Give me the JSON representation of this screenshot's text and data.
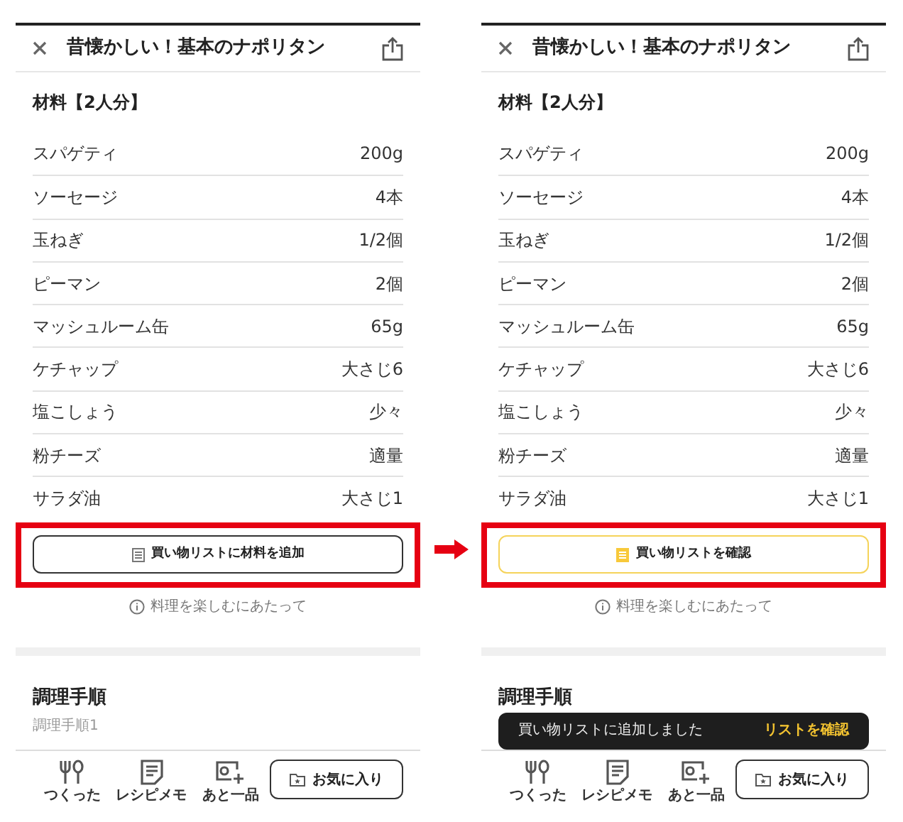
{
  "screens": [
    {
      "title": "昔懐かしい！基本のナポリタン",
      "section_title": "材料【2人分】",
      "ingredients": [
        {
          "name": "スパゲティ",
          "amount": "200g"
        },
        {
          "name": "ソーセージ",
          "amount": "4本"
        },
        {
          "name": "玉ねぎ",
          "amount": "1/2個"
        },
        {
          "name": "ピーマン",
          "amount": "2個"
        },
        {
          "name": "マッシュルーム缶",
          "amount": "65g"
        },
        {
          "name": "ケチャップ",
          "amount": "大さじ6"
        },
        {
          "name": "塩こしょう",
          "amount": "少々"
        },
        {
          "name": "粉チーズ",
          "amount": "適量"
        },
        {
          "name": "サラダ油",
          "amount": "大さじ1"
        }
      ],
      "list_button": {
        "label": "買い物リストに材料を追加",
        "added": false,
        "highlighted": true
      },
      "info_link": "料理を楽しむにあたって",
      "steps_title": "調理手順",
      "steps_subtitle": "調理手順1",
      "tab_bar": [
        {
          "kind": "cutlery",
          "label": "つくった"
        },
        {
          "kind": "memo",
          "label": "レシピメモ"
        },
        {
          "kind": "photo",
          "label": "あと一品"
        }
      ],
      "favorite_button": "お気に入り"
    },
    {
      "title": "昔懐かしい！基本のナポリタン",
      "section_title": "材料【2人分】",
      "ingredients": [
        {
          "name": "スパゲティ",
          "amount": "200g"
        },
        {
          "name": "ソーセージ",
          "amount": "4本"
        },
        {
          "name": "玉ねぎ",
          "amount": "1/2個"
        },
        {
          "name": "ピーマン",
          "amount": "2個"
        },
        {
          "name": "マッシュルーム缶",
          "amount": "65g"
        },
        {
          "name": "ケチャップ",
          "amount": "大さじ6"
        },
        {
          "name": "塩こしょう",
          "amount": "少々"
        },
        {
          "name": "粉チーズ",
          "amount": "適量"
        },
        {
          "name": "サラダ油",
          "amount": "大さじ1"
        }
      ],
      "list_button": {
        "label": "買い物リストを確認",
        "added": true,
        "highlighted": true
      },
      "info_link": "料理を楽しむにあたって",
      "steps_title": "調理手順",
      "toast": {
        "message": "買い物リストに追加しました",
        "action": "リストを確認"
      },
      "tab_bar": [
        {
          "kind": "cutlery",
          "label": "つくった"
        },
        {
          "kind": "memo",
          "label": "レシピメモ"
        },
        {
          "kind": "photo",
          "label": "あと一品"
        }
      ],
      "favorite_button": "お気に入り"
    }
  ]
}
